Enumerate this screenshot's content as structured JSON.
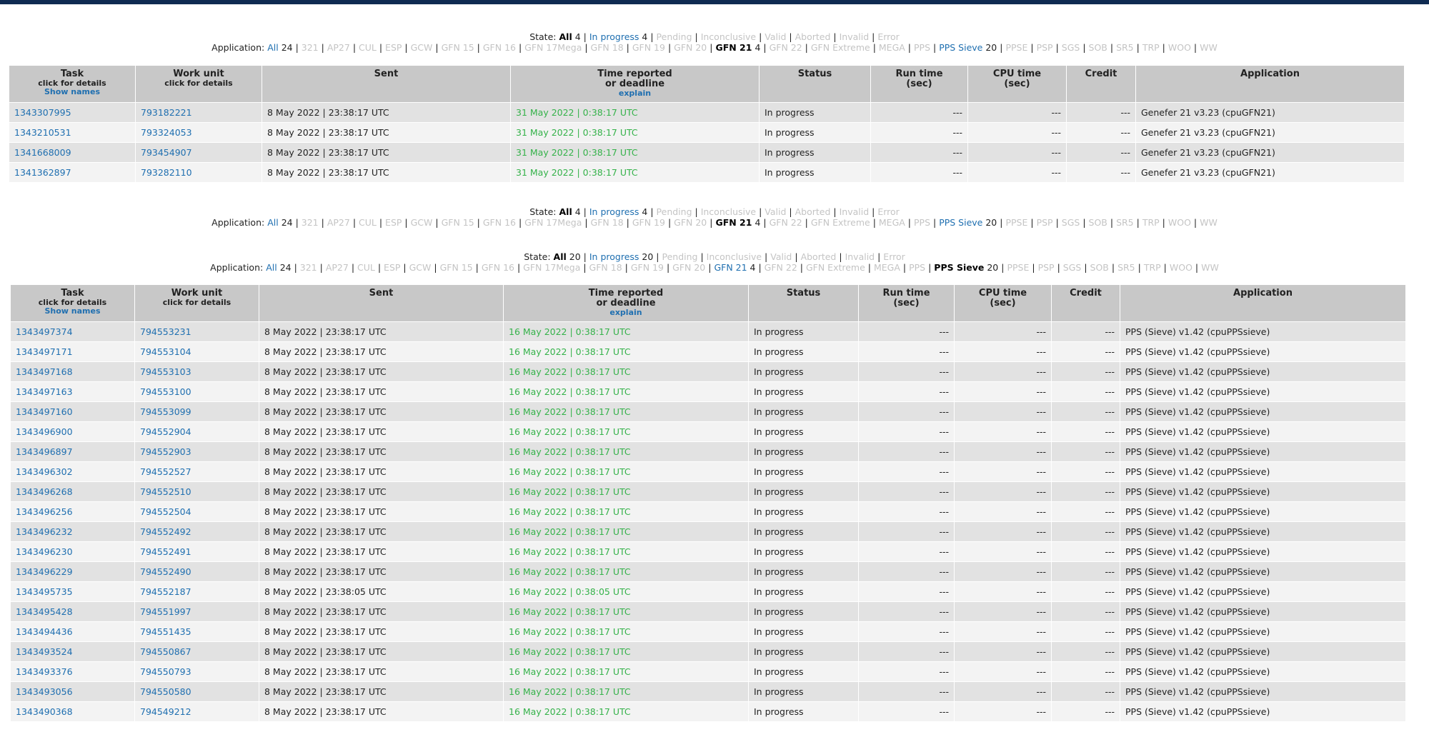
{
  "filters": {
    "state_label": "State:",
    "app_label": "Application:",
    "sep": "|",
    "state_gfn": [
      {
        "label": "All",
        "count": "4",
        "style": "cur"
      },
      {
        "label": "In progress",
        "count": "4",
        "style": "active"
      },
      {
        "label": "Pending",
        "count": "",
        "style": "dim"
      },
      {
        "label": "Inconclusive",
        "count": "",
        "style": "dim"
      },
      {
        "label": "Valid",
        "count": "",
        "style": "dim"
      },
      {
        "label": "Aborted",
        "count": "",
        "style": "dim"
      },
      {
        "label": "Invalid",
        "count": "",
        "style": "dim"
      },
      {
        "label": "Error",
        "count": "",
        "style": "dim"
      }
    ],
    "state_pps": [
      {
        "label": "All",
        "count": "20",
        "style": "cur"
      },
      {
        "label": "In progress",
        "count": "20",
        "style": "active"
      },
      {
        "label": "Pending",
        "count": "",
        "style": "dim"
      },
      {
        "label": "Inconclusive",
        "count": "",
        "style": "dim"
      },
      {
        "label": "Valid",
        "count": "",
        "style": "dim"
      },
      {
        "label": "Aborted",
        "count": "",
        "style": "dim"
      },
      {
        "label": "Invalid",
        "count": "",
        "style": "dim"
      },
      {
        "label": "Error",
        "count": "",
        "style": "dim"
      }
    ],
    "app_gfn": [
      {
        "label": "All",
        "count": "24",
        "style": "active"
      },
      {
        "label": "321",
        "count": "",
        "style": "dim"
      },
      {
        "label": "AP27",
        "count": "",
        "style": "dim"
      },
      {
        "label": "CUL",
        "count": "",
        "style": "dim"
      },
      {
        "label": "ESP",
        "count": "",
        "style": "dim"
      },
      {
        "label": "GCW",
        "count": "",
        "style": "dim"
      },
      {
        "label": "GFN 15",
        "count": "",
        "style": "dim"
      },
      {
        "label": "GFN 16",
        "count": "",
        "style": "dim"
      },
      {
        "label": "GFN 17Mega",
        "count": "",
        "style": "dim"
      },
      {
        "label": "GFN 18",
        "count": "",
        "style": "dim"
      },
      {
        "label": "GFN 19",
        "count": "",
        "style": "dim"
      },
      {
        "label": "GFN 20",
        "count": "",
        "style": "dim"
      },
      {
        "label": "GFN 21",
        "count": "4",
        "style": "cur"
      },
      {
        "label": "GFN 22",
        "count": "",
        "style": "dim"
      },
      {
        "label": "GFN Extreme",
        "count": "",
        "style": "dim"
      },
      {
        "label": "MEGA",
        "count": "",
        "style": "dim"
      },
      {
        "label": "PPS",
        "count": "",
        "style": "dim"
      },
      {
        "label": "PPS Sieve",
        "count": "20",
        "style": "active"
      },
      {
        "label": "PPSE",
        "count": "",
        "style": "dim"
      },
      {
        "label": "PSP",
        "count": "",
        "style": "dim"
      },
      {
        "label": "SGS",
        "count": "",
        "style": "dim"
      },
      {
        "label": "SOB",
        "count": "",
        "style": "dim"
      },
      {
        "label": "SR5",
        "count": "",
        "style": "dim"
      },
      {
        "label": "TRP",
        "count": "",
        "style": "dim"
      },
      {
        "label": "WOO",
        "count": "",
        "style": "dim"
      },
      {
        "label": "WW",
        "count": "",
        "style": "dim"
      }
    ],
    "app_pps": [
      {
        "label": "All",
        "count": "24",
        "style": "active"
      },
      {
        "label": "321",
        "count": "",
        "style": "dim"
      },
      {
        "label": "AP27",
        "count": "",
        "style": "dim"
      },
      {
        "label": "CUL",
        "count": "",
        "style": "dim"
      },
      {
        "label": "ESP",
        "count": "",
        "style": "dim"
      },
      {
        "label": "GCW",
        "count": "",
        "style": "dim"
      },
      {
        "label": "GFN 15",
        "count": "",
        "style": "dim"
      },
      {
        "label": "GFN 16",
        "count": "",
        "style": "dim"
      },
      {
        "label": "GFN 17Mega",
        "count": "",
        "style": "dim"
      },
      {
        "label": "GFN 18",
        "count": "",
        "style": "dim"
      },
      {
        "label": "GFN 19",
        "count": "",
        "style": "dim"
      },
      {
        "label": "GFN 20",
        "count": "",
        "style": "dim"
      },
      {
        "label": "GFN 21",
        "count": "4",
        "style": "active"
      },
      {
        "label": "GFN 22",
        "count": "",
        "style": "dim"
      },
      {
        "label": "GFN Extreme",
        "count": "",
        "style": "dim"
      },
      {
        "label": "MEGA",
        "count": "",
        "style": "dim"
      },
      {
        "label": "PPS",
        "count": "",
        "style": "dim"
      },
      {
        "label": "PPS Sieve",
        "count": "20",
        "style": "cur"
      },
      {
        "label": "PPSE",
        "count": "",
        "style": "dim"
      },
      {
        "label": "PSP",
        "count": "",
        "style": "dim"
      },
      {
        "label": "SGS",
        "count": "",
        "style": "dim"
      },
      {
        "label": "SOB",
        "count": "",
        "style": "dim"
      },
      {
        "label": "SR5",
        "count": "",
        "style": "dim"
      },
      {
        "label": "TRP",
        "count": "",
        "style": "dim"
      },
      {
        "label": "WOO",
        "count": "",
        "style": "dim"
      },
      {
        "label": "WW",
        "count": "",
        "style": "dim"
      }
    ]
  },
  "headers": {
    "task": "Task",
    "task_sub": "click for details",
    "show_names": "Show names",
    "workunit": "Work unit",
    "workunit_sub": "click for details",
    "sent": "Sent",
    "time_reported": "Time reported",
    "or_deadline": "or deadline",
    "explain": "explain",
    "status": "Status",
    "run_time": "Run time",
    "cpu_time": "CPU time",
    "sec": "(sec)",
    "credit": "Credit",
    "application": "Application"
  },
  "gfn_rows": [
    {
      "task": "1343307995",
      "wu": "793182221",
      "sent": "8 May 2022 | 23:38:17 UTC",
      "deadline": "31 May 2022 | 0:38:17 UTC",
      "status": "In progress",
      "run": "---",
      "cpu": "---",
      "credit": "---",
      "app": "Genefer 21 v3.23 (cpuGFN21)"
    },
    {
      "task": "1343210531",
      "wu": "793324053",
      "sent": "8 May 2022 | 23:38:17 UTC",
      "deadline": "31 May 2022 | 0:38:17 UTC",
      "status": "In progress",
      "run": "---",
      "cpu": "---",
      "credit": "---",
      "app": "Genefer 21 v3.23 (cpuGFN21)"
    },
    {
      "task": "1341668009",
      "wu": "793454907",
      "sent": "8 May 2022 | 23:38:17 UTC",
      "deadline": "31 May 2022 | 0:38:17 UTC",
      "status": "In progress",
      "run": "---",
      "cpu": "---",
      "credit": "---",
      "app": "Genefer 21 v3.23 (cpuGFN21)"
    },
    {
      "task": "1341362897",
      "wu": "793282110",
      "sent": "8 May 2022 | 23:38:17 UTC",
      "deadline": "31 May 2022 | 0:38:17 UTC",
      "status": "In progress",
      "run": "---",
      "cpu": "---",
      "credit": "---",
      "app": "Genefer 21 v3.23 (cpuGFN21)"
    }
  ],
  "pps_rows": [
    {
      "task": "1343497374",
      "wu": "794553231",
      "sent": "8 May 2022 | 23:38:17 UTC",
      "deadline": "16 May 2022 | 0:38:17 UTC",
      "status": "In progress",
      "run": "---",
      "cpu": "---",
      "credit": "---",
      "app": "PPS (Sieve) v1.42 (cpuPPSsieve)"
    },
    {
      "task": "1343497171",
      "wu": "794553104",
      "sent": "8 May 2022 | 23:38:17 UTC",
      "deadline": "16 May 2022 | 0:38:17 UTC",
      "status": "In progress",
      "run": "---",
      "cpu": "---",
      "credit": "---",
      "app": "PPS (Sieve) v1.42 (cpuPPSsieve)"
    },
    {
      "task": "1343497168",
      "wu": "794553103",
      "sent": "8 May 2022 | 23:38:17 UTC",
      "deadline": "16 May 2022 | 0:38:17 UTC",
      "status": "In progress",
      "run": "---",
      "cpu": "---",
      "credit": "---",
      "app": "PPS (Sieve) v1.42 (cpuPPSsieve)"
    },
    {
      "task": "1343497163",
      "wu": "794553100",
      "sent": "8 May 2022 | 23:38:17 UTC",
      "deadline": "16 May 2022 | 0:38:17 UTC",
      "status": "In progress",
      "run": "---",
      "cpu": "---",
      "credit": "---",
      "app": "PPS (Sieve) v1.42 (cpuPPSsieve)"
    },
    {
      "task": "1343497160",
      "wu": "794553099",
      "sent": "8 May 2022 | 23:38:17 UTC",
      "deadline": "16 May 2022 | 0:38:17 UTC",
      "status": "In progress",
      "run": "---",
      "cpu": "---",
      "credit": "---",
      "app": "PPS (Sieve) v1.42 (cpuPPSsieve)"
    },
    {
      "task": "1343496900",
      "wu": "794552904",
      "sent": "8 May 2022 | 23:38:17 UTC",
      "deadline": "16 May 2022 | 0:38:17 UTC",
      "status": "In progress",
      "run": "---",
      "cpu": "---",
      "credit": "---",
      "app": "PPS (Sieve) v1.42 (cpuPPSsieve)"
    },
    {
      "task": "1343496897",
      "wu": "794552903",
      "sent": "8 May 2022 | 23:38:17 UTC",
      "deadline": "16 May 2022 | 0:38:17 UTC",
      "status": "In progress",
      "run": "---",
      "cpu": "---",
      "credit": "---",
      "app": "PPS (Sieve) v1.42 (cpuPPSsieve)"
    },
    {
      "task": "1343496302",
      "wu": "794552527",
      "sent": "8 May 2022 | 23:38:17 UTC",
      "deadline": "16 May 2022 | 0:38:17 UTC",
      "status": "In progress",
      "run": "---",
      "cpu": "---",
      "credit": "---",
      "app": "PPS (Sieve) v1.42 (cpuPPSsieve)"
    },
    {
      "task": "1343496268",
      "wu": "794552510",
      "sent": "8 May 2022 | 23:38:17 UTC",
      "deadline": "16 May 2022 | 0:38:17 UTC",
      "status": "In progress",
      "run": "---",
      "cpu": "---",
      "credit": "---",
      "app": "PPS (Sieve) v1.42 (cpuPPSsieve)"
    },
    {
      "task": "1343496256",
      "wu": "794552504",
      "sent": "8 May 2022 | 23:38:17 UTC",
      "deadline": "16 May 2022 | 0:38:17 UTC",
      "status": "In progress",
      "run": "---",
      "cpu": "---",
      "credit": "---",
      "app": "PPS (Sieve) v1.42 (cpuPPSsieve)"
    },
    {
      "task": "1343496232",
      "wu": "794552492",
      "sent": "8 May 2022 | 23:38:17 UTC",
      "deadline": "16 May 2022 | 0:38:17 UTC",
      "status": "In progress",
      "run": "---",
      "cpu": "---",
      "credit": "---",
      "app": "PPS (Sieve) v1.42 (cpuPPSsieve)"
    },
    {
      "task": "1343496230",
      "wu": "794552491",
      "sent": "8 May 2022 | 23:38:17 UTC",
      "deadline": "16 May 2022 | 0:38:17 UTC",
      "status": "In progress",
      "run": "---",
      "cpu": "---",
      "credit": "---",
      "app": "PPS (Sieve) v1.42 (cpuPPSsieve)"
    },
    {
      "task": "1343496229",
      "wu": "794552490",
      "sent": "8 May 2022 | 23:38:17 UTC",
      "deadline": "16 May 2022 | 0:38:17 UTC",
      "status": "In progress",
      "run": "---",
      "cpu": "---",
      "credit": "---",
      "app": "PPS (Sieve) v1.42 (cpuPPSsieve)"
    },
    {
      "task": "1343495735",
      "wu": "794552187",
      "sent": "8 May 2022 | 23:38:05 UTC",
      "deadline": "16 May 2022 | 0:38:05 UTC",
      "status": "In progress",
      "run": "---",
      "cpu": "---",
      "credit": "---",
      "app": "PPS (Sieve) v1.42 (cpuPPSsieve)"
    },
    {
      "task": "1343495428",
      "wu": "794551997",
      "sent": "8 May 2022 | 23:38:17 UTC",
      "deadline": "16 May 2022 | 0:38:17 UTC",
      "status": "In progress",
      "run": "---",
      "cpu": "---",
      "credit": "---",
      "app": "PPS (Sieve) v1.42 (cpuPPSsieve)"
    },
    {
      "task": "1343494436",
      "wu": "794551435",
      "sent": "8 May 2022 | 23:38:17 UTC",
      "deadline": "16 May 2022 | 0:38:17 UTC",
      "status": "In progress",
      "run": "---",
      "cpu": "---",
      "credit": "---",
      "app": "PPS (Sieve) v1.42 (cpuPPSsieve)"
    },
    {
      "task": "1343493524",
      "wu": "794550867",
      "sent": "8 May 2022 | 23:38:17 UTC",
      "deadline": "16 May 2022 | 0:38:17 UTC",
      "status": "In progress",
      "run": "---",
      "cpu": "---",
      "credit": "---",
      "app": "PPS (Sieve) v1.42 (cpuPPSsieve)"
    },
    {
      "task": "1343493376",
      "wu": "794550793",
      "sent": "8 May 2022 | 23:38:17 UTC",
      "deadline": "16 May 2022 | 0:38:17 UTC",
      "status": "In progress",
      "run": "---",
      "cpu": "---",
      "credit": "---",
      "app": "PPS (Sieve) v1.42 (cpuPPSsieve)"
    },
    {
      "task": "1343493056",
      "wu": "794550580",
      "sent": "8 May 2022 | 23:38:17 UTC",
      "deadline": "16 May 2022 | 0:38:17 UTC",
      "status": "In progress",
      "run": "---",
      "cpu": "---",
      "credit": "---",
      "app": "PPS (Sieve) v1.42 (cpuPPSsieve)"
    },
    {
      "task": "1343490368",
      "wu": "794549212",
      "sent": "8 May 2022 | 23:38:17 UTC",
      "deadline": "16 May 2022 | 0:38:17 UTC",
      "status": "In progress",
      "run": "---",
      "cpu": "---",
      "credit": "---",
      "app": "PPS (Sieve) v1.42 (cpuPPSsieve)"
    }
  ]
}
